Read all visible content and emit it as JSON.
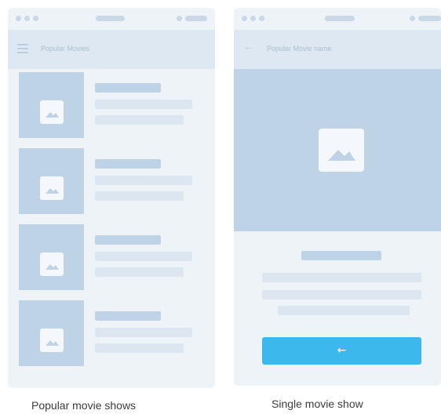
{
  "screens": {
    "list": {
      "nav_title": "Popular Movies",
      "nav_icon": "hamburger-menu-icon",
      "item_icon": "image-placeholder-icon",
      "item_count": 4,
      "caption": "Popular movie shows"
    },
    "detail": {
      "nav_title": "Popular Movie name",
      "nav_icon": "back-arrow-icon",
      "hero_icon": "image-placeholder-icon",
      "button_icon": "back-arrow-icon",
      "button_label": "←",
      "caption": "Single movie show"
    }
  },
  "colors": {
    "background": "#eef3f8",
    "nav_bar": "#dde8f2",
    "placeholder": "#bed3e5",
    "text_line": "#dbe6f0",
    "accent_button": "#3cb8ec",
    "caption_text": "#3d3d3d"
  }
}
